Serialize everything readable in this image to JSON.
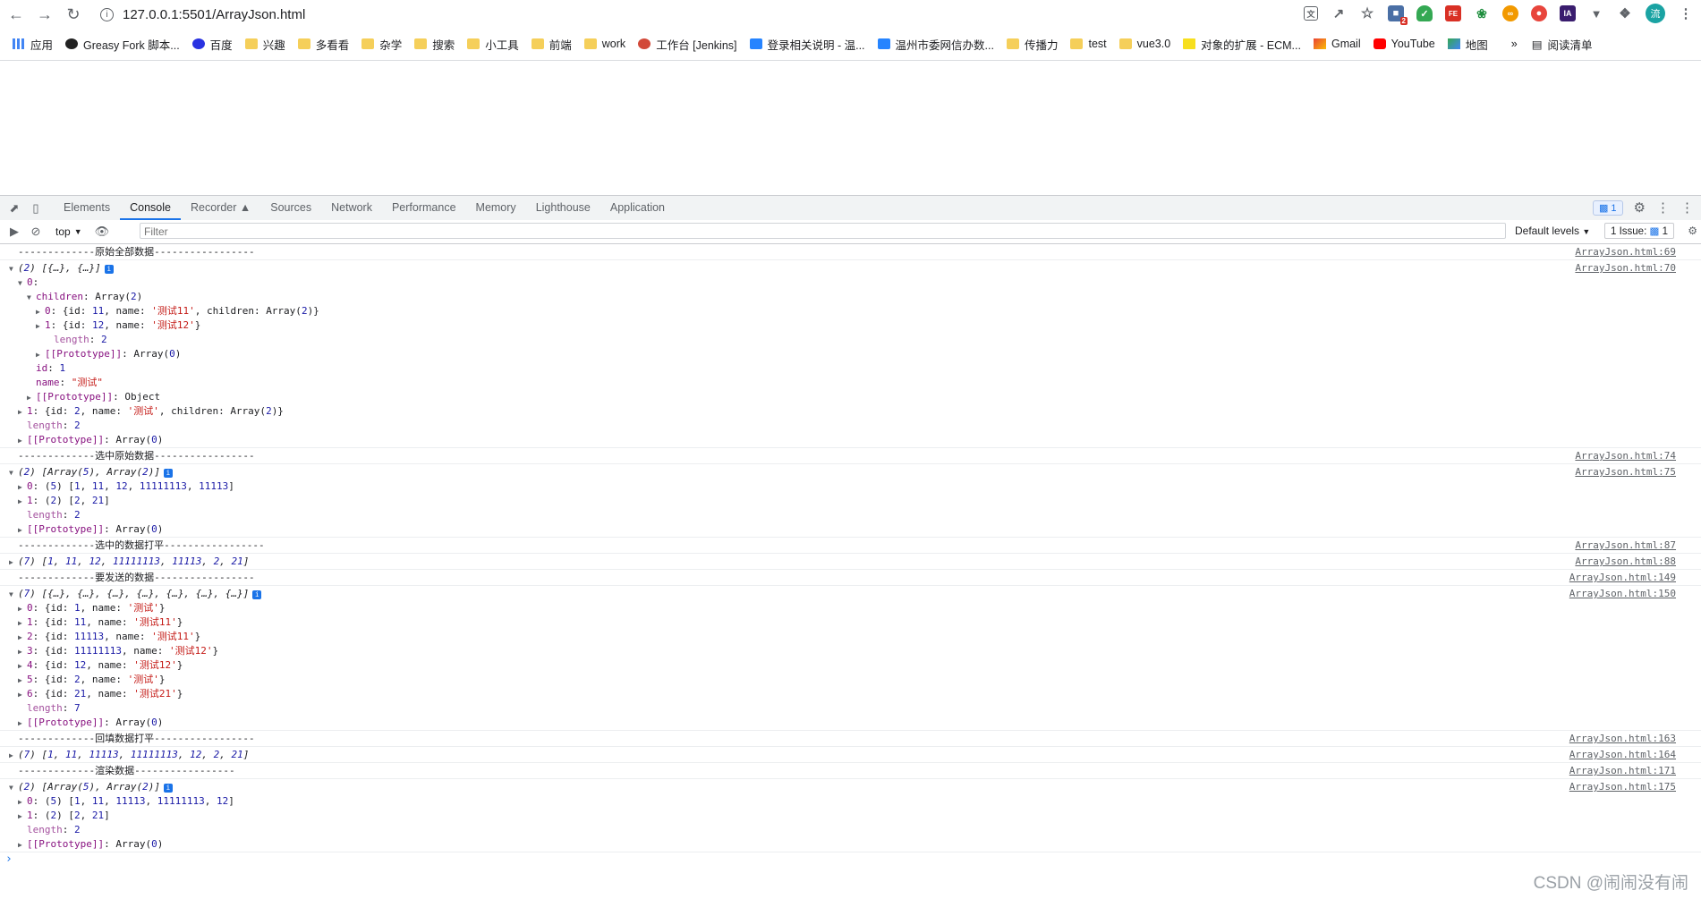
{
  "browser": {
    "url": "127.0.0.1:5501/ArrayJson.html",
    "avatar_initial": "流",
    "ext_badge": "2"
  },
  "bookmarks": [
    {
      "label": "应用",
      "icon": "apps-grid-icon"
    },
    {
      "label": "Greasy Fork 脚本...",
      "icon": "greasyfork-icon"
    },
    {
      "label": "百度",
      "icon": "baidu-icon"
    },
    {
      "label": "兴趣",
      "icon": "folder-icon"
    },
    {
      "label": "多看看",
      "icon": "folder-icon"
    },
    {
      "label": "杂学",
      "icon": "folder-icon"
    },
    {
      "label": "搜索",
      "icon": "folder-icon"
    },
    {
      "label": "小工具",
      "icon": "folder-icon"
    },
    {
      "label": "前端",
      "icon": "folder-icon"
    },
    {
      "label": "work",
      "icon": "folder-icon"
    },
    {
      "label": "工作台 [Jenkins]",
      "icon": "jenkins-icon"
    },
    {
      "label": "登录相关说明 - 温...",
      "icon": "confluence-icon"
    },
    {
      "label": "温州市委网信办数...",
      "icon": "confluence-icon"
    },
    {
      "label": "传播力",
      "icon": "folder-icon"
    },
    {
      "label": "test",
      "icon": "folder-icon"
    },
    {
      "label": "vue3.0",
      "icon": "folder-icon"
    },
    {
      "label": "对象的扩展 - ECM...",
      "icon": "es-icon"
    },
    {
      "label": "Gmail",
      "icon": "gmail-icon"
    },
    {
      "label": "YouTube",
      "icon": "youtube-icon"
    },
    {
      "label": "地图",
      "icon": "maps-icon"
    }
  ],
  "bookmarks_more": "»",
  "reading_list": "阅读清单",
  "devtools": {
    "tabs": [
      "Elements",
      "Console",
      "Recorder",
      "Sources",
      "Network",
      "Performance",
      "Memory",
      "Lighthouse",
      "Application"
    ],
    "active_tab": "Console",
    "messages_badge": "1",
    "context": "top",
    "filter_placeholder": "Filter",
    "levels": "Default levels",
    "issues_label": "1 Issue:",
    "issues_count": "1"
  },
  "console": {
    "sections": [
      {
        "lines": [
          "-------------原始全部数据-----------------"
        ],
        "src": "ArrayJson.html:69"
      },
      {
        "src": "ArrayJson.html:70",
        "lines": [
          "(2) [{…}, {…}]",
          "0:",
          "children: Array(2)",
          "0: {id: 11, name: '测试11', children: Array(2)}",
          "1: {id: 12, name: '测试12'}",
          "length: 2",
          "[[Prototype]]: Array(0)",
          "id: 1",
          "name: \"测试\"",
          "[[Prototype]]: Object",
          "1: {id: 2, name: '测试', children: Array(2)}",
          "length: 2",
          "[[Prototype]]: Array(0)"
        ]
      },
      {
        "lines": [
          "-------------选中原始数据-----------------"
        ],
        "src": "ArrayJson.html:74"
      },
      {
        "src": "ArrayJson.html:75",
        "lines": [
          "(2) [Array(5), Array(2)]",
          "0: (5) [1, 11, 12, 11111113, 11113]",
          "1: (2) [2, 21]",
          "length: 2",
          "[[Prototype]]: Array(0)"
        ]
      },
      {
        "lines": [
          "-------------选中的数据打平-----------------"
        ],
        "src": "ArrayJson.html:87"
      },
      {
        "lines": [
          "(7) [1, 11, 12, 11111113, 11113, 2, 21]"
        ],
        "src": "ArrayJson.html:88"
      },
      {
        "lines": [
          "-------------要发送的数据-----------------"
        ],
        "src": "ArrayJson.html:149"
      },
      {
        "src": "ArrayJson.html:150",
        "lines": [
          "(7) [{…}, {…}, {…}, {…}, {…}, {…}, {…}]",
          "0: {id: 1, name: '测试'}",
          "1: {id: 11, name: '测试11'}",
          "2: {id: 11113, name: '测试11'}",
          "3: {id: 11111113, name: '测试12'}",
          "4: {id: 12, name: '测试12'}",
          "5: {id: 2, name: '测试'}",
          "6: {id: 21, name: '测试21'}",
          "length: 7",
          "[[Prototype]]: Array(0)"
        ]
      },
      {
        "lines": [
          "-------------回填数据打平-----------------"
        ],
        "src": "ArrayJson.html:163"
      },
      {
        "lines": [
          "(7) [1, 11, 11113, 11111113, 12, 2, 21]"
        ],
        "src": "ArrayJson.html:164"
      },
      {
        "lines": [
          "-------------渲染数据-----------------"
        ],
        "src": "ArrayJson.html:171"
      },
      {
        "src": "ArrayJson.html:175",
        "lines": [
          "(2) [Array(5), Array(2)]",
          "0: (5) [1, 11, 11113, 11111113, 12]",
          "1: (2) [2, 21]",
          "length: 2",
          "[[Prototype]]: Array(0)"
        ]
      }
    ],
    "prompt": "›"
  },
  "watermark": "CSDN @闹闹没有闹"
}
